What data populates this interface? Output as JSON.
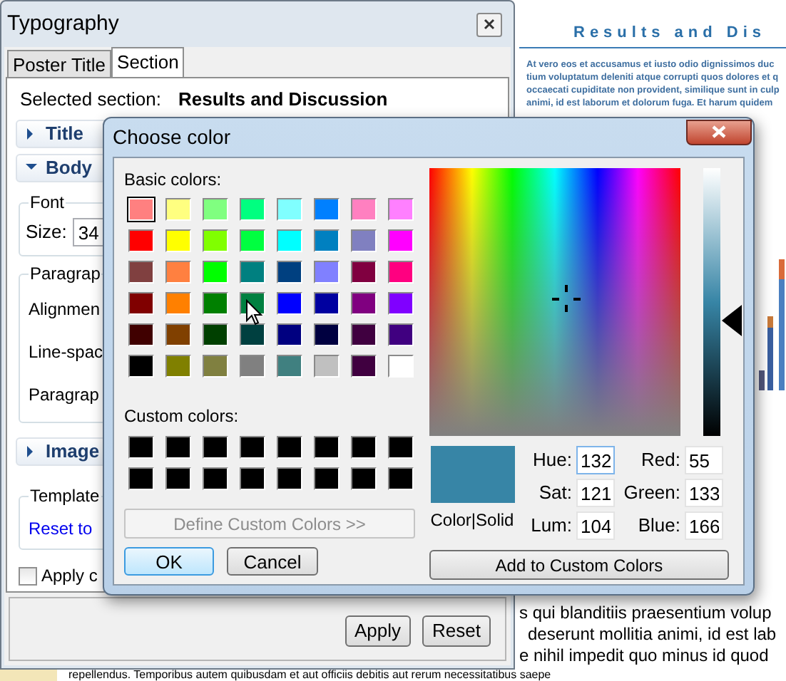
{
  "poster": {
    "heading": "Results and Dis",
    "lines_top": [
      "At vero eos et accusamus et iusto odio dignissimos duc",
      "tium voluptatum deleniti atque corrupti quos dolores et q",
      "occaecati cupiditate non provident, similique sunt in culp",
      "animi, id est laborum et dolorum fuga. Et harum quidem"
    ],
    "lines_bottom": [
      "s qui blanditiis praesentium volup",
      "deserunt mollitia animi, id est lab",
      "e nihil impedit quo minus id quod"
    ],
    "last_line": "repellendus. Temporibus autem quibusdam et aut officiis debitis aut rerum necessitatibus saepe"
  },
  "typography": {
    "title": "Typography",
    "tabs": [
      {
        "label": "Poster Title",
        "selected": false
      },
      {
        "label": "Section",
        "selected": true
      }
    ],
    "selected_label": "Selected section:",
    "selected_value": "Results and Discussion",
    "title_section": {
      "label": "Title",
      "expanded": false
    },
    "body_section": {
      "label": "Body",
      "expanded": true
    },
    "font_group": {
      "label": "Font",
      "size_label": "Size:",
      "size": "34"
    },
    "paragraph_group": {
      "label": "Paragrap",
      "rows": [
        "Alignmen",
        "Line-spac",
        "Paragrap"
      ]
    },
    "image_section": {
      "label": "Image",
      "expanded": false
    },
    "template_group": {
      "label": "Template",
      "link": "Reset to"
    },
    "apply_checkbox": {
      "label": "Apply c",
      "checked": false
    },
    "buttons": [
      "Apply",
      "Reset"
    ]
  },
  "color_dialog": {
    "title": "Choose color",
    "basic_label": "Basic colors:",
    "basic_colors": [
      {
        "color": "#ff8080",
        "selected": true
      },
      {
        "color": "#ffff80",
        "selected": false
      },
      {
        "color": "#80ff80",
        "selected": false
      },
      {
        "color": "#00ff80",
        "selected": false
      },
      {
        "color": "#80ffff",
        "selected": false
      },
      {
        "color": "#0080ff",
        "selected": false
      },
      {
        "color": "#ff80c0",
        "selected": false
      },
      {
        "color": "#ff80ff",
        "selected": false
      },
      {
        "color": "#ff0000",
        "selected": false
      },
      {
        "color": "#ffff00",
        "selected": false
      },
      {
        "color": "#80ff00",
        "selected": false
      },
      {
        "color": "#00ff40",
        "selected": false
      },
      {
        "color": "#00ffff",
        "selected": false
      },
      {
        "color": "#0080c0",
        "selected": false
      },
      {
        "color": "#8080c0",
        "selected": false
      },
      {
        "color": "#ff00ff",
        "selected": false
      },
      {
        "color": "#804040",
        "selected": false
      },
      {
        "color": "#ff8040",
        "selected": false
      },
      {
        "color": "#00ff00",
        "selected": false
      },
      {
        "color": "#008080",
        "selected": false
      },
      {
        "color": "#004080",
        "selected": false
      },
      {
        "color": "#8080ff",
        "selected": false
      },
      {
        "color": "#800040",
        "selected": false
      },
      {
        "color": "#ff0080",
        "selected": false
      },
      {
        "color": "#800000",
        "selected": false
      },
      {
        "color": "#ff8000",
        "selected": false
      },
      {
        "color": "#008000",
        "selected": false
      },
      {
        "color": "#008040",
        "selected": false
      },
      {
        "color": "#0000ff",
        "selected": false
      },
      {
        "color": "#0000a0",
        "selected": false
      },
      {
        "color": "#800080",
        "selected": false
      },
      {
        "color": "#8000ff",
        "selected": false
      },
      {
        "color": "#400000",
        "selected": false
      },
      {
        "color": "#804000",
        "selected": false
      },
      {
        "color": "#004000",
        "selected": false
      },
      {
        "color": "#004040",
        "selected": false
      },
      {
        "color": "#000080",
        "selected": false
      },
      {
        "color": "#000040",
        "selected": false
      },
      {
        "color": "#400040",
        "selected": false
      },
      {
        "color": "#400080",
        "selected": false
      },
      {
        "color": "#000000",
        "selected": false
      },
      {
        "color": "#808000",
        "selected": false
      },
      {
        "color": "#808040",
        "selected": false
      },
      {
        "color": "#808080",
        "selected": false
      },
      {
        "color": "#408080",
        "selected": false
      },
      {
        "color": "#c0c0c0",
        "selected": false
      },
      {
        "color": "#400040",
        "selected": false
      },
      {
        "color": "#ffffff",
        "selected": false
      }
    ],
    "custom_label": "Custom colors:",
    "custom_colors": [
      {
        "color": "#000000",
        "selected": false
      },
      {
        "color": "#000000",
        "selected": false
      },
      {
        "color": "#000000",
        "selected": false
      },
      {
        "color": "#000000",
        "selected": false
      },
      {
        "color": "#000000",
        "selected": false
      },
      {
        "color": "#000000",
        "selected": false
      },
      {
        "color": "#000000",
        "selected": false
      },
      {
        "color": "#000000",
        "selected": false
      },
      {
        "color": "#000000",
        "selected": false
      },
      {
        "color": "#000000",
        "selected": false
      },
      {
        "color": "#000000",
        "selected": false
      },
      {
        "color": "#000000",
        "selected": false
      },
      {
        "color": "#000000",
        "selected": false
      },
      {
        "color": "#000000",
        "selected": false
      },
      {
        "color": "#000000",
        "selected": false
      },
      {
        "color": "#000000",
        "selected": false
      }
    ],
    "define_button": {
      "label": "Define Custom Colors >>",
      "disabled": true
    },
    "ok": "OK",
    "cancel": "Cancel",
    "preview_label": "Color|Solid",
    "fields": [
      {
        "label": "Hue:",
        "value": "132"
      },
      {
        "label": "Red:",
        "value": "55"
      },
      {
        "label": "Sat:",
        "value": "121"
      },
      {
        "label": "Green:",
        "value": "133"
      },
      {
        "label": "Lum:",
        "value": "104"
      },
      {
        "label": "Blue:",
        "value": "166"
      }
    ],
    "add_button": "Add to Custom Colors"
  }
}
